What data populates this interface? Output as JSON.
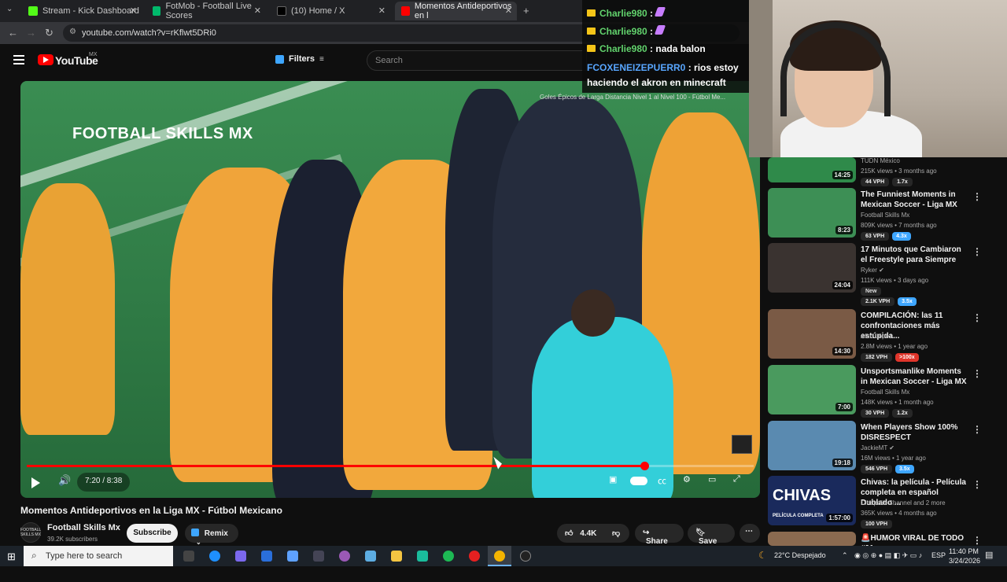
{
  "browser": {
    "tabs": [
      {
        "label": "Stream - Kick Dashboard",
        "color": "#53fc18"
      },
      {
        "label": "FotMob - Football Live Scores",
        "color": "#00b96b"
      },
      {
        "label": "(10) Home / X",
        "color": "#000000"
      },
      {
        "label": "Momentos Antideportivos en l",
        "color": "#ff0000"
      }
    ],
    "new_tab": "+",
    "close": "✕",
    "url": "youtube.com/watch?v=rKflwt5DRi0"
  },
  "youtube": {
    "logo_text": "YouTube",
    "country": "MX",
    "filters_label": "Filters",
    "search_placeholder": "Search"
  },
  "video": {
    "watermark": "FOOTBALL SKILLS MX",
    "playlist_title": "Goles Épicos de Larga Distancia Nivel 1 al Nivel 100 - Fútbol Me...",
    "time": "7:20 / 8:38",
    "progress": 0.85,
    "title": "Momentos Antideportivos en la Liga MX - Fútbol Mexicano"
  },
  "channel": {
    "avatar_text": "FOOTBALL SKILLS MX",
    "name": "Football Skills Mx",
    "subscribers": "39.2K subscribers",
    "subscribe_label": "Subscribe",
    "remix_label": "Remix",
    "likes": "4.4K",
    "share_label": "Share",
    "save_label": "Save"
  },
  "chat": [
    {
      "user": "Charlie980",
      "sep": " :",
      "text": "",
      "emote": true
    },
    {
      "user": "Charlie980",
      "sep": " :",
      "text": "",
      "emote": true
    },
    {
      "user": "Charlie980",
      "sep": " :",
      "text": " nada balon",
      "emote": false
    },
    {
      "user": "FCOXENEIZEPUERR0",
      "sep": " :",
      "text": " rios estoy haciendo el akron en minecraft",
      "emote": false
    }
  ],
  "recommendations": [
    {
      "title": "",
      "channel": "TUDN México",
      "meta": "215K views • 3 months ago",
      "vph": "44 VPH",
      "mult": "1.7x",
      "mult_style": "plain",
      "duration": "14:25",
      "thumb": "#2f8a4a"
    },
    {
      "title": "The Funniest Moments in Mexican Soccer - Liga MX",
      "channel": "Football Skills Mx",
      "meta": "809K views • 7 months ago",
      "vph": "63 VPH",
      "mult": "4.3x",
      "mult_style": "blue",
      "duration": "8:23",
      "thumb": "#3d8f55"
    },
    {
      "title": "17 Minutos que Cambiaron el Freestyle para Siempre",
      "channel": "Ryker ✔",
      "meta": "111K views • 3 days ago",
      "tag": "New",
      "vph": "2.1K VPH",
      "mult": "3.5x",
      "mult_style": "blue",
      "duration": "24:04",
      "thumb": "#3a3330"
    },
    {
      "title": "COMPILACIÓN: las 11 confrontaciones más estúpida...",
      "channel": "Alan López",
      "meta": "2.8M views • 1 year ago",
      "vph": "182 VPH",
      "mult": ">100x",
      "mult_style": "red",
      "duration": "14:30",
      "thumb": "#7a5a45"
    },
    {
      "title": "Unsportsmanlike Moments in Mexican Soccer - Liga MX",
      "channel": "Football Skills Mx",
      "meta": "148K views • 1 month ago",
      "vph": "30 VPH",
      "mult": "1.2x",
      "mult_style": "plain",
      "duration": "7:00",
      "thumb": "#4a9a5e"
    },
    {
      "title": "When Players Show 100% DISRESPECT",
      "channel": "JackieMT ✔",
      "meta": "16M views • 1 year ago",
      "vph": "546 VPH",
      "mult": "3.5x",
      "mult_style": "blue",
      "duration": "19:18",
      "thumb": "#5a8ab0"
    },
    {
      "title": "Chivas: la película - Película completa en español Dublado ...",
      "channel": "Cinépolis Channel and 2 more",
      "meta": "365K views • 4 months ago",
      "vph": "100 VPH",
      "mult": "",
      "mult_style": "none",
      "duration": "1:57:00",
      "thumb": "#1a2a5c",
      "thumb_text": "CHIVAS",
      "thumb_sub": "PELÍCULA COMPLETA"
    },
    {
      "title": "🚨HUMOR VIRAL DE TODO #91",
      "channel": "",
      "meta": "",
      "vph": "",
      "mult": "",
      "mult_style": "none",
      "duration": "",
      "thumb": "#8a6a50"
    }
  ],
  "taskbar": {
    "search_placeholder": "Type here to search",
    "weather": "22°C  Despejado",
    "lang": "ESP",
    "time": "11:40 PM",
    "date": "3/24/2026"
  }
}
